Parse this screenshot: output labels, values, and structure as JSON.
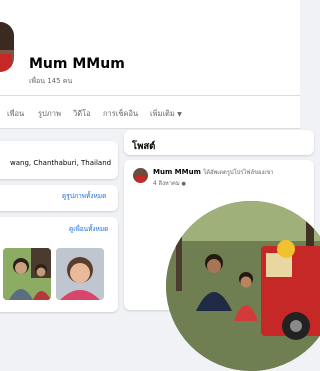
{
  "profile": {
    "name": "Mum MMum",
    "friends_count": "เพื่อน 145 คน"
  },
  "nav": {
    "items": [
      "เพื่อน",
      "รูปภาพ",
      "วิดีโอ",
      "การเช็คอิน",
      "เพิ่มเติม"
    ]
  },
  "intro": {
    "location": "wang, Chanthaburi, Thailand"
  },
  "photos": {
    "see_all": "ดูรูปภาพทั้งหมด"
  },
  "friends": {
    "see_all": "ดูเพื่อนทั้งหมด"
  },
  "posts": {
    "title": "โพสต์",
    "author": "Mum MMum",
    "action": "ได้อัพเดตรูปโปรไฟล์ของเขา",
    "date": "4 สิงหาคม"
  },
  "colors": {
    "link": "#216fdb",
    "secondary_text": "#65676b",
    "background": "#f0f2f5"
  }
}
